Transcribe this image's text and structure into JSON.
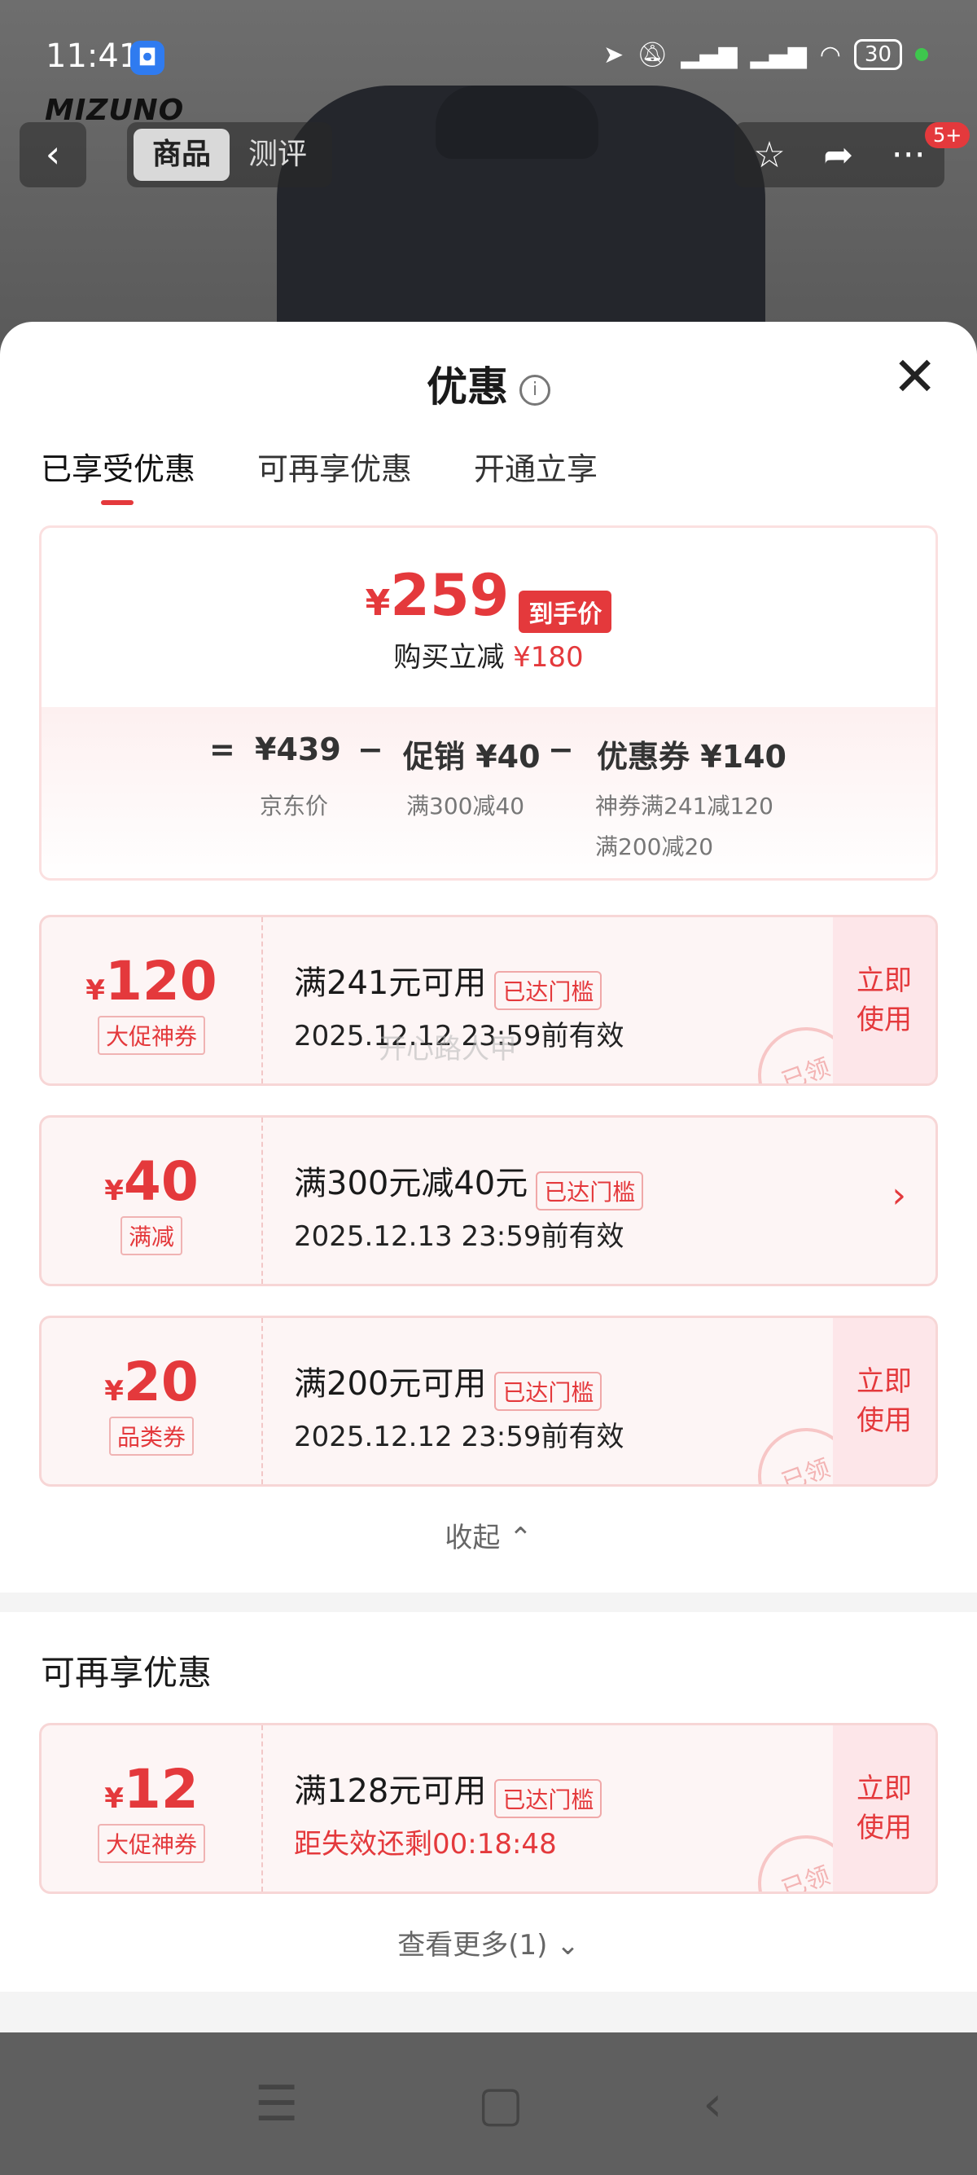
{
  "status_bar": {
    "time": "11:41",
    "battery": "30",
    "app_icon": "shield-app-icon"
  },
  "top_bar": {
    "segments": [
      "商品",
      "测评"
    ],
    "active_segment": 0,
    "badge": "5+",
    "brand_logo": "MIZUNO"
  },
  "sheet": {
    "title": "优惠",
    "tabs": [
      "已享受优惠",
      "可再享优惠",
      "开通立享"
    ],
    "active_tab": 0
  },
  "summary": {
    "yen": "¥",
    "final_price": "259",
    "final_tag": "到手价",
    "buy_discount_label": "购买立减",
    "buy_discount_value": "¥180",
    "eq": "=",
    "jd_price": "¥439",
    "jd_label": "京东价",
    "minus": "−",
    "promo": "促销 ¥40",
    "promo_sub": "满300减40",
    "coupon": "优惠券 ¥140",
    "coupon_sub1": "神券满241减120",
    "coupon_sub2": "满200减20"
  },
  "coupons": [
    {
      "yen": "¥",
      "amount": "120",
      "type": "大促神券",
      "title": "满241元可用",
      "badge": "已达门槛",
      "date": "2025.12.12 23:59前有效",
      "action": "立即使用",
      "stamp": "已领"
    },
    {
      "yen": "¥",
      "amount": "40",
      "type": "满减",
      "title": "满300元减40元",
      "badge": "已达门槛",
      "date": "2025.12.13 23:59前有效"
    },
    {
      "yen": "¥",
      "amount": "20",
      "type": "品类券",
      "title": "满200元可用",
      "badge": "已达门槛",
      "date": "2025.12.12 23:59前有效",
      "action": "立即使用",
      "stamp": "已领"
    }
  ],
  "collapse_label": "收起",
  "more_section": {
    "title": "可再享优惠",
    "coupon": {
      "yen": "¥",
      "amount": "12",
      "type": "大促神券",
      "title": "满128元可用",
      "badge": "已达门槛",
      "date": "距失效还剩00:18:48",
      "action": "立即使用",
      "stamp": "已领"
    },
    "see_more": "查看更多(1)"
  },
  "watermark": "开心路人甲",
  "colors": {
    "accent": "#e4393c",
    "coupon_bg": "#fdf5f5"
  }
}
